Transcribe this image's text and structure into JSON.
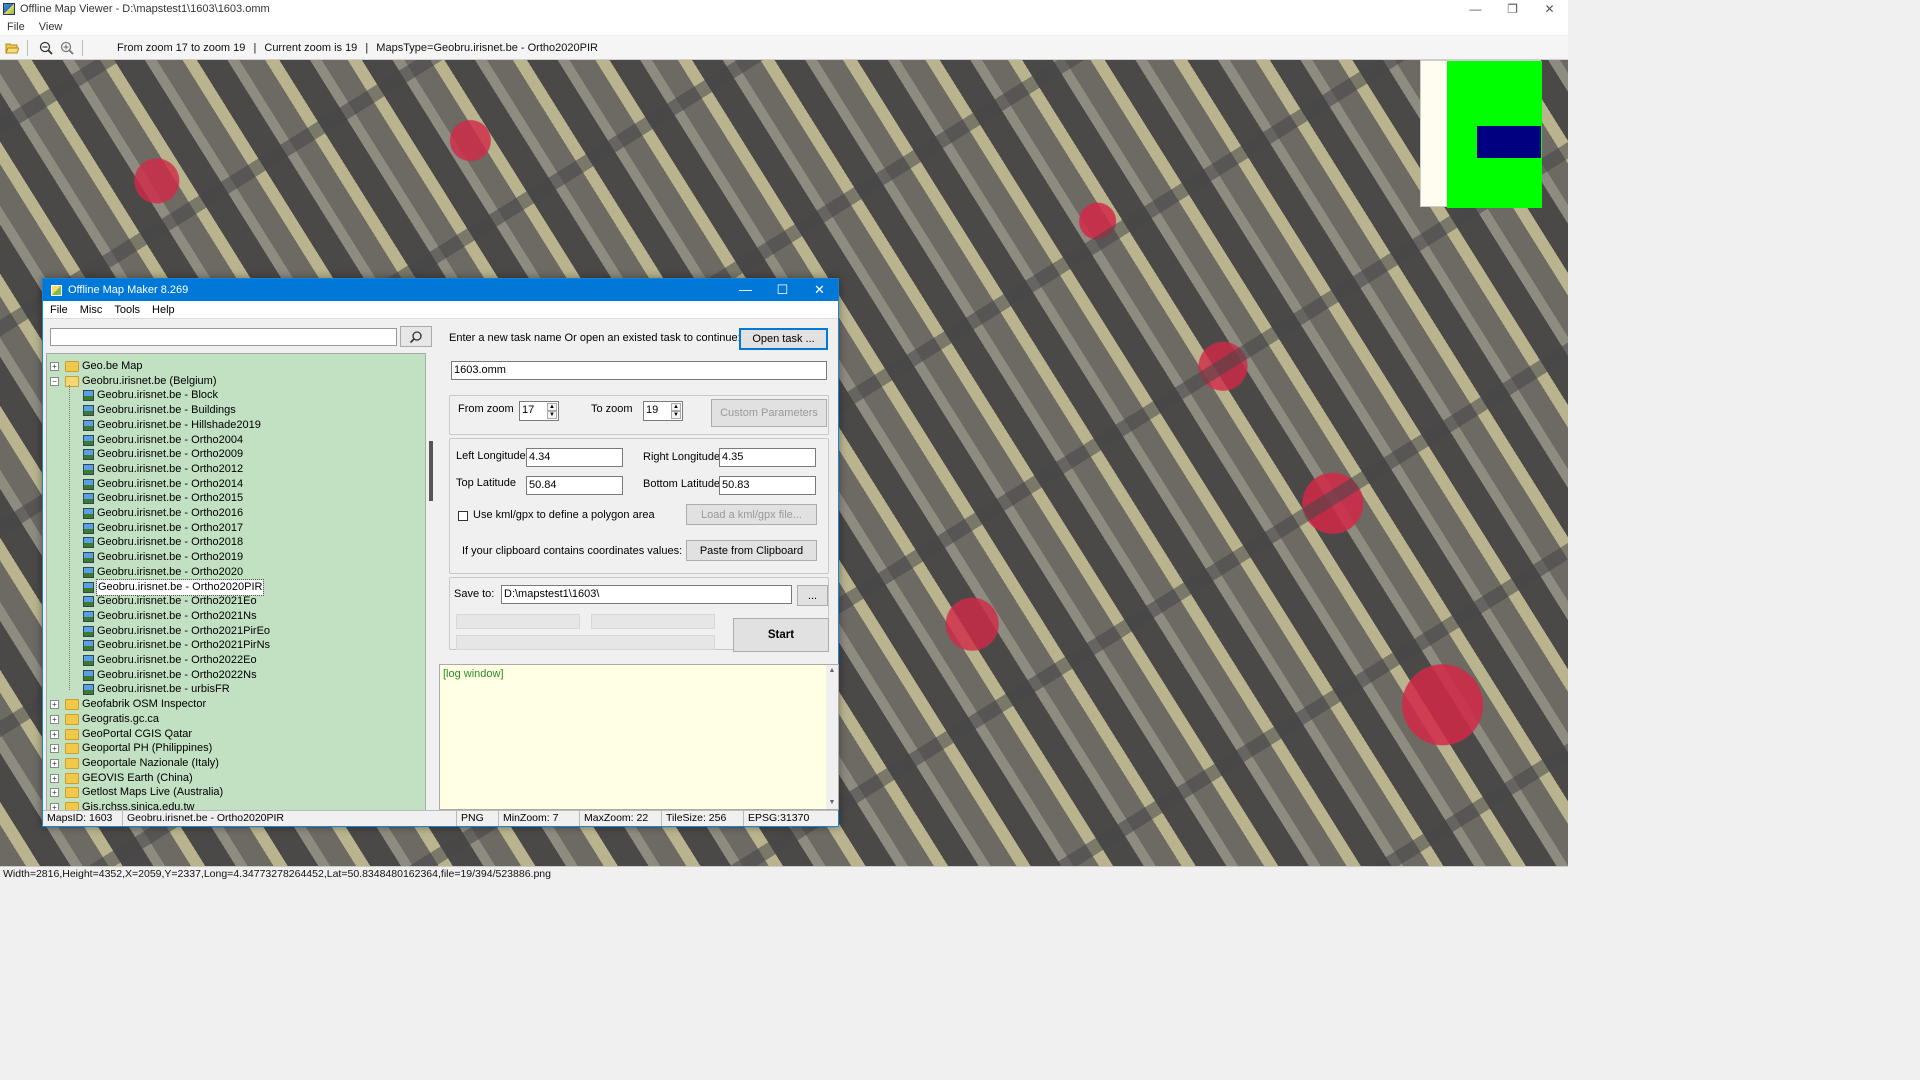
{
  "viewer": {
    "title": "Offline Map Viewer - D:\\mapstest1\\1603\\1603.omm",
    "menu": [
      "File",
      "View"
    ],
    "toolbar_info": {
      "zoom_range": "From zoom 17 to zoom 19",
      "sep1": "|",
      "current_zoom": "Current zoom is 19",
      "sep2": "|",
      "maps_type": "MapsType=Geobru.irisnet.be - Ortho2020PIR"
    },
    "status": "Width=2816,Height=4352,X=2059,Y=2337,Long=4.34773278264452,Lat=50.8348480162364,file=19/394/523886.png",
    "window_controls": [
      "—",
      "❐",
      "✕"
    ]
  },
  "dialog": {
    "title": "Offline Map Maker 8.269",
    "menu": [
      "File",
      "Misc",
      "Tools",
      "Help"
    ],
    "search": {
      "value": "",
      "placeholder": ""
    },
    "tree": {
      "before": [
        {
          "label": "Geo.be Map",
          "expander": "+"
        }
      ],
      "open_folder": {
        "label": "Geobru.irisnet.be (Belgium)",
        "expander": "−"
      },
      "children": [
        "Geobru.irisnet.be - Block",
        "Geobru.irisnet.be - Buildings",
        "Geobru.irisnet.be - Hillshade2019",
        "Geobru.irisnet.be - Ortho2004",
        "Geobru.irisnet.be - Ortho2009",
        "Geobru.irisnet.be - Ortho2012",
        "Geobru.irisnet.be - Ortho2014",
        "Geobru.irisnet.be - Ortho2015",
        "Geobru.irisnet.be - Ortho2016",
        "Geobru.irisnet.be - Ortho2017",
        "Geobru.irisnet.be - Ortho2018",
        "Geobru.irisnet.be - Ortho2019",
        "Geobru.irisnet.be - Ortho2020",
        "Geobru.irisnet.be - Ortho2020PIR",
        "Geobru.irisnet.be - Ortho2021Eo",
        "Geobru.irisnet.be - Ortho2021Ns",
        "Geobru.irisnet.be - Ortho2021PirEo",
        "Geobru.irisnet.be - Ortho2021PirNs",
        "Geobru.irisnet.be - Ortho2022Eo",
        "Geobru.irisnet.be - Ortho2022Ns",
        "Geobru.irisnet.be - urbisFR"
      ],
      "selected_child": "Geobru.irisnet.be - Ortho2020PIR",
      "after": [
        "Geofabrik OSM Inspector",
        "Geogratis.gc.ca",
        "GeoPortal CGIS Qatar",
        "Geoportal PH (Philippines)",
        "Geoportale Nazionale (Italy)",
        "GEOVIS Earth (China)",
        "Getlost Maps Live (Australia)",
        "Gis.rchss.sinica.edu.tw"
      ]
    },
    "task_prompt": "Enter a new task name Or open an existed task to continue:",
    "open_task_label": "Open task ...",
    "task_name": "1603.omm",
    "from_zoom_label": "From zoom",
    "from_zoom": "17",
    "to_zoom_label": "To zoom",
    "to_zoom": "19",
    "custom_params_label": "Custom Parameters",
    "left_lon_label": "Left Longitude",
    "left_lon": "4.34",
    "right_lon_label": "Right Longitude",
    "right_lon": "4.35",
    "top_lat_label": "Top Latitude",
    "top_lat": "50.84",
    "bottom_lat_label": "Bottom Latitude",
    "bottom_lat": "50.83",
    "kml_checkbox_label": "Use kml/gpx to define a polygon area",
    "kml_checked": false,
    "load_kml_label": "Load a kml/gpx file...",
    "clipboard_prompt": "If your clipboard contains coordinates values:",
    "paste_label": "Paste from Clipboard",
    "save_to_label": "Save to:",
    "save_to": "D:\\mapstest1\\1603\\",
    "browse_label": "...",
    "start_label": "Start",
    "log_text": "[log window]",
    "status": {
      "maps_id": "MapsID: 1603",
      "maps_name": "Geobru.irisnet.be - Ortho2020PIR",
      "format": "PNG",
      "min_zoom": "MinZoom: 7",
      "max_zoom": "MaxZoom: 22",
      "tile_size": "TileSize: 256",
      "epsg": "EPSG:31370"
    },
    "window_controls": [
      "—",
      "☐",
      "✕"
    ]
  },
  "colors": {
    "dialog_titlebar": "#0078d7",
    "tree_background": "#c2e0c2",
    "log_background": "#ffffe3",
    "log_text": "#2d8c2d",
    "minimap_green": "#00ff00",
    "minimap_blue": "#000080"
  },
  "icons": {
    "open_folder_toolbar": "folder-open-icon",
    "zoom_out": "zoom-out-icon",
    "zoom_in": "zoom-in-icon",
    "search": "search-icon"
  }
}
